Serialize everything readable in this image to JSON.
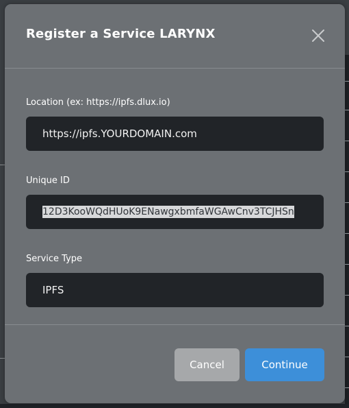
{
  "modal": {
    "title": "Register a Service LARYNX",
    "close_icon": "close-icon"
  },
  "fields": {
    "location": {
      "label": "Location (ex: https://ipfs.dlux.io)",
      "value": "https://ipfs.YOURDOMAIN.com"
    },
    "unique_id": {
      "label": "Unique ID",
      "value": "12D3KooWQdHUoK9ENawgxbmfaWGAwCnv3TCJHSn"
    },
    "service_type": {
      "label": "Service Type",
      "value": "IPFS"
    }
  },
  "footer": {
    "cancel_label": "Cancel",
    "continue_label": "Continue"
  },
  "colors": {
    "modal_bg": "#6c7074",
    "input_bg": "#212428",
    "cancel_bg": "#a6a8aa",
    "continue_bg": "#3d8fd9"
  }
}
